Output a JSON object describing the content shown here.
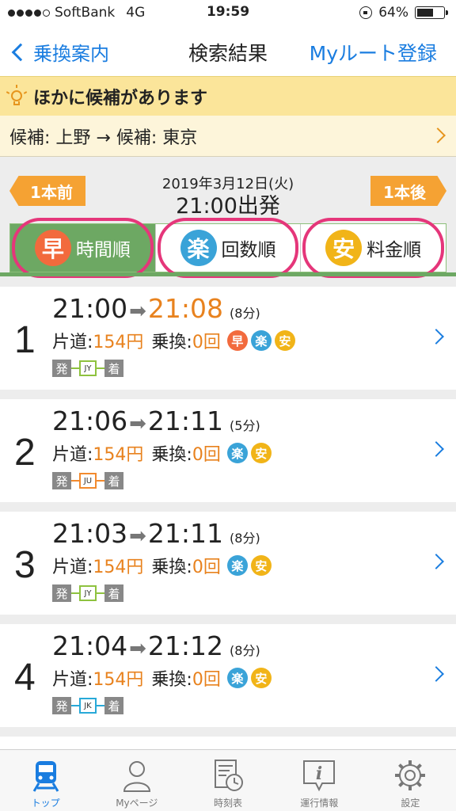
{
  "status_bar": {
    "carrier": "SoftBank",
    "network": "4G",
    "time": "19:59",
    "battery": "64%",
    "battery_level": 0.64
  },
  "nav": {
    "back_label": "乗換案内",
    "title": "検索結果",
    "right_label": "Myルート登録"
  },
  "alternatives": {
    "title": "ほかに候補があります",
    "route_text": "候補: 上野 → 候補: 東京"
  },
  "date_bar": {
    "prev_label": "1本前",
    "next_label": "1本後",
    "date": "2019年3月12日(火)",
    "departure": "21:00出発"
  },
  "sort_tabs": [
    {
      "badge": "早",
      "label": "時間順",
      "active": true,
      "color": "#f26a3d"
    },
    {
      "badge": "楽",
      "label": "回数順",
      "active": false,
      "color": "#3aa3d8"
    },
    {
      "badge": "安",
      "label": "料金順",
      "active": false,
      "color": "#f1b418"
    }
  ],
  "routes": [
    {
      "num": "1",
      "dep": "21:00",
      "arr": "21:08",
      "duration": "(8分)",
      "fare_label": "片道:",
      "fare": "154円",
      "transfer_label": "乗換:",
      "transfers": "0回",
      "badges": [
        "早",
        "楽",
        "安"
      ],
      "from": "発",
      "line": "JY",
      "line_color": "#8ec23f",
      "to": "着"
    },
    {
      "num": "2",
      "dep": "21:06",
      "arr": "21:11",
      "duration": "(5分)",
      "fare_label": "片道:",
      "fare": "154円",
      "transfer_label": "乗換:",
      "transfers": "0回",
      "badges": [
        "楽",
        "安"
      ],
      "from": "発",
      "line": "JU",
      "line_color": "#f28a2e",
      "to": "着"
    },
    {
      "num": "3",
      "dep": "21:03",
      "arr": "21:11",
      "duration": "(8分)",
      "fare_label": "片道:",
      "fare": "154円",
      "transfer_label": "乗換:",
      "transfers": "0回",
      "badges": [
        "楽",
        "安"
      ],
      "from": "発",
      "line": "JY",
      "line_color": "#8ec23f",
      "to": "着"
    },
    {
      "num": "4",
      "dep": "21:04",
      "arr": "21:12",
      "duration": "(8分)",
      "fare_label": "片道:",
      "fare": "154円",
      "transfer_label": "乗換:",
      "transfers": "0回",
      "badges": [
        "楽",
        "安"
      ],
      "from": "発",
      "line": "JK",
      "line_color": "#28a9d8",
      "to": "着"
    }
  ],
  "badge_colors": {
    "早": "#f26a3d",
    "楽": "#3aa3d8",
    "安": "#f1b418"
  },
  "tab_bar": [
    {
      "icon": "train-icon",
      "label": "トップ",
      "active": true
    },
    {
      "icon": "person-icon",
      "label": "Myページ",
      "active": false
    },
    {
      "icon": "timetable-icon",
      "label": "時刻表",
      "active": false
    },
    {
      "icon": "info-icon",
      "label": "運行情報",
      "active": false
    },
    {
      "icon": "gear-icon",
      "label": "設定",
      "active": false
    }
  ]
}
